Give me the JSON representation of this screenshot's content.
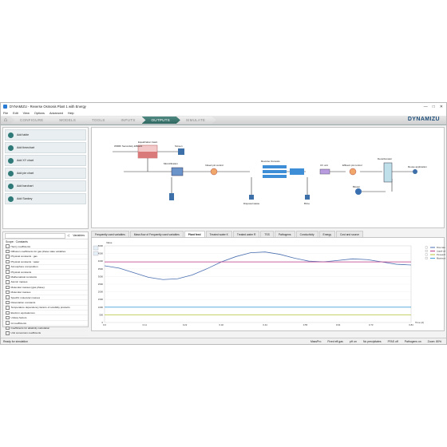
{
  "window": {
    "title": "DYNAMIZU - Reverse Osmosis Plant 1 with Energy",
    "controls": [
      "—",
      "□",
      "✕"
    ]
  },
  "menu": [
    "File",
    "Edit",
    "View",
    "Options",
    "Advanced",
    "Help"
  ],
  "nav": {
    "tabs": [
      {
        "label": "CONFIGURE",
        "active": false
      },
      {
        "label": "MODELS",
        "active": false
      },
      {
        "label": "TOOLS",
        "active": false
      },
      {
        "label": "INPUTS",
        "active": false
      },
      {
        "label": "OUTPUTS",
        "active": true
      },
      {
        "label": "SIMULATE",
        "active": false
      }
    ],
    "brand": "DYNAMIZU"
  },
  "add_panel": {
    "items": [
      "Add table",
      "Add timechart",
      "Add XY chart",
      "Add pie chart",
      "Add barchart",
      "Add Sankey"
    ]
  },
  "variables_panel": {
    "tab_label": "Variables",
    "filter_label": "Scope:",
    "filter_value": "Constants",
    "items": [
      "Henry coefficients",
      "Diffusion coefficients for gas phase state variables",
      "Physical constants : gas",
      "Physical constants : water",
      "Atmosphere composition",
      "Physical constants",
      "Mathematical constants",
      "Atomic masses",
      "Molecular masses (gas phase)",
      "Molecular masses",
      "Specific molecular masses",
      "Dissociation constants",
      "Temperature dependency factors of solubility products",
      "Electron equivalences",
      "Unitary factors",
      "GI coefficients",
      "Coefficients for alkalinity calculation",
      "Unit conversion coefficients"
    ]
  },
  "flowsheet": {
    "labels": {
      "source": "WRRF Secondary Effluent",
      "eq_basin": "Equalization basin",
      "screen": "Screen",
      "microfiltration": "Microfiltration",
      "infeed_ph": "Infeed pH control",
      "ro": "Reverse Osmosis",
      "uv": "UV unit",
      "effluent_ph": "Effluent pH control",
      "decarb": "Decarbonator",
      "blower": "Blower",
      "reuse": "Reuse application",
      "disposal": "Disposal waste",
      "brine": "Brine"
    }
  },
  "plot_tabs": [
    {
      "label": "Frequently used variables",
      "active": false
    },
    {
      "label": "Mass flow of Frequently used variables",
      "active": false
    },
    {
      "label": "Plant feed",
      "active": true
    },
    {
      "label": "Treated water K",
      "active": false
    },
    {
      "label": "Treated water R",
      "active": false
    },
    {
      "label": "TSS",
      "active": false
    },
    {
      "label": "Pathogens",
      "active": false
    },
    {
      "label": "Conductivity",
      "active": false
    },
    {
      "label": "Energy",
      "active": false
    },
    {
      "label": "Cost and source",
      "active": false
    }
  ],
  "chart_data": {
    "type": "line",
    "ylabel": "Value",
    "xlabel": "Time (d)",
    "xlim": [
      0,
      0.84
    ],
    "ylim": [
      0,
      5000
    ],
    "yticks": [
      0,
      500,
      1000,
      1500,
      2000,
      2500,
      3000,
      3500,
      4000,
      4500,
      5000
    ],
    "xticks": [
      "0.0",
      "0.11",
      "0.22",
      "0.32",
      "0.44",
      "0.55",
      "0.64",
      "0.73",
      "0.84"
    ],
    "series": [
      {
        "name": "Flow rate (WRRF Secondary Effluent) (m3/d)",
        "color": "#4a6fb0",
        "x": [
          0,
          0.04,
          0.08,
          0.12,
          0.16,
          0.2,
          0.24,
          0.28,
          0.32,
          0.36,
          0.4,
          0.44,
          0.48,
          0.52,
          0.56,
          0.6,
          0.64,
          0.68,
          0.72,
          0.76,
          0.8,
          0.84
        ],
        "y": [
          3700,
          3550,
          3250,
          2950,
          2800,
          2850,
          3100,
          3500,
          3950,
          4300,
          4550,
          4600,
          4450,
          4200,
          4000,
          3950,
          4050,
          4150,
          4100,
          3950,
          3800,
          3750
        ]
      },
      {
        "name": "Liquid volume (Equalization basin) (m3)",
        "color": "#c03a8a",
        "x": [
          0,
          0.84
        ],
        "y": [
          3950,
          3950
        ]
      },
      {
        "name": "Pumped flow rate (Equalization basin) (m3/d)",
        "color": "#b8c43a",
        "x": [
          0,
          0.84
        ],
        "y": [
          500,
          500
        ]
      },
      {
        "name": "Maximum liquid volume (Equalization basin) (m3)",
        "color": "#46a0d6",
        "x": [
          0,
          0.84
        ],
        "y": [
          1000,
          1000
        ]
      }
    ]
  },
  "statusbar": {
    "left": "Ready for simulation",
    "items": [
      "MassPro",
      "Fixed eff-gas",
      "pH on",
      "No precipitates",
      "FFAS off",
      "Pathogens on",
      "Zoom: 80%"
    ]
  }
}
